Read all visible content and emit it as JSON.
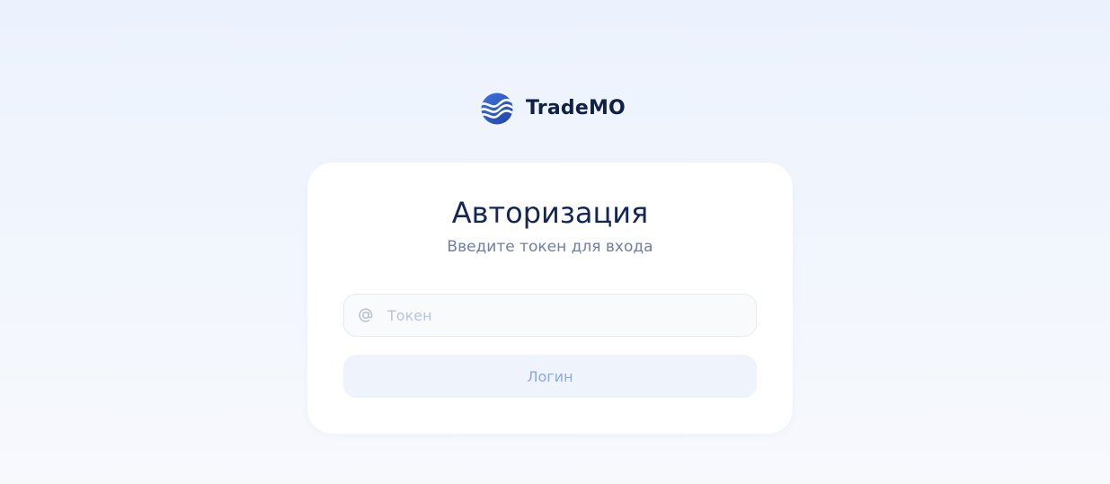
{
  "brand": {
    "name": "TradeMO",
    "logo_icon": "wave-globe-icon",
    "logo_color": "#2f5fd0"
  },
  "auth": {
    "title": "Авторизация",
    "subtitle": "Введите токен для входа",
    "token_field": {
      "icon": "at-sign-icon",
      "value": "",
      "placeholder": "Токен"
    },
    "login_label": "Логин"
  },
  "colors": {
    "title": "#13265a",
    "subtitle": "#6b7fa8",
    "button_bg": "#eef3fc",
    "button_text": "#8eaadb"
  }
}
